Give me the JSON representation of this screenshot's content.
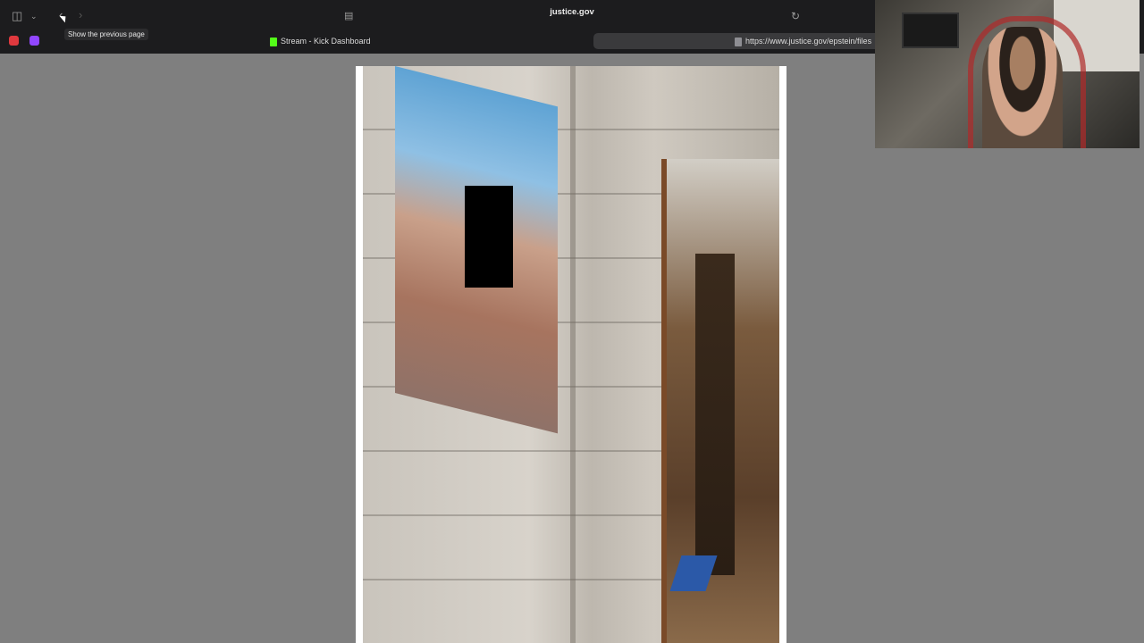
{
  "browser": {
    "address": "justice.gov",
    "tooltip": "Show the previous page",
    "tabs": [
      {
        "label": "Stream - Kick Dashboard"
      },
      {
        "label": "https://www.justice.gov/epstein/files"
      }
    ],
    "icons": [
      "sidebar-icon",
      "chevron-down-icon",
      "back-icon",
      "forward-icon",
      "page-settings-icon",
      "reload-icon"
    ]
  },
  "colors": {
    "toolbar": "#1c1c1e",
    "background": "#7f7f7f",
    "kick_green": "#53fc18",
    "twitch_purple": "#9146ff",
    "pin_red": "#e0393e"
  }
}
